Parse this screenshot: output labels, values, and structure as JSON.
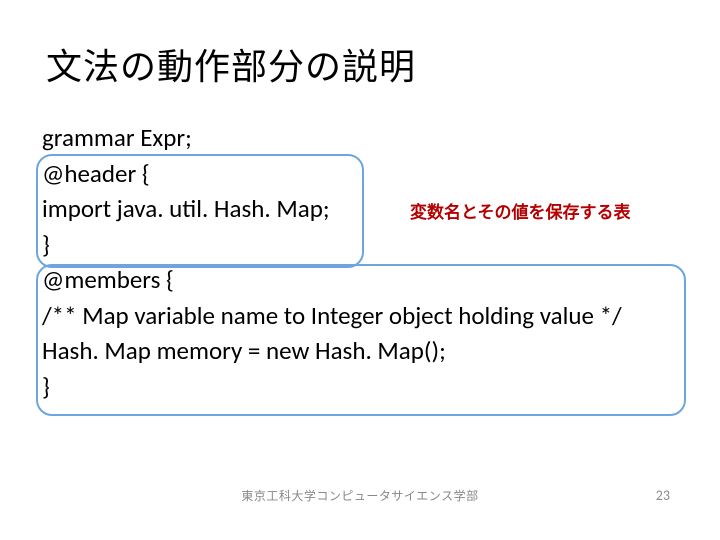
{
  "title": "文法の動作部分の説明",
  "code": {
    "l1": "grammar Expr;",
    "l2": "@header {",
    "l3": "import java. util. Hash. Map;",
    "l4": "}",
    "l5": "@members {",
    "l6": "/** Map variable name to Integer object holding value */",
    "l7": "Hash. Map memory = new Hash. Map();",
    "l8": "}"
  },
  "note": "変数名とその値を保存する表",
  "footer": {
    "center": "東京工科大学コンピュータサイエンス学部",
    "page": "23"
  }
}
